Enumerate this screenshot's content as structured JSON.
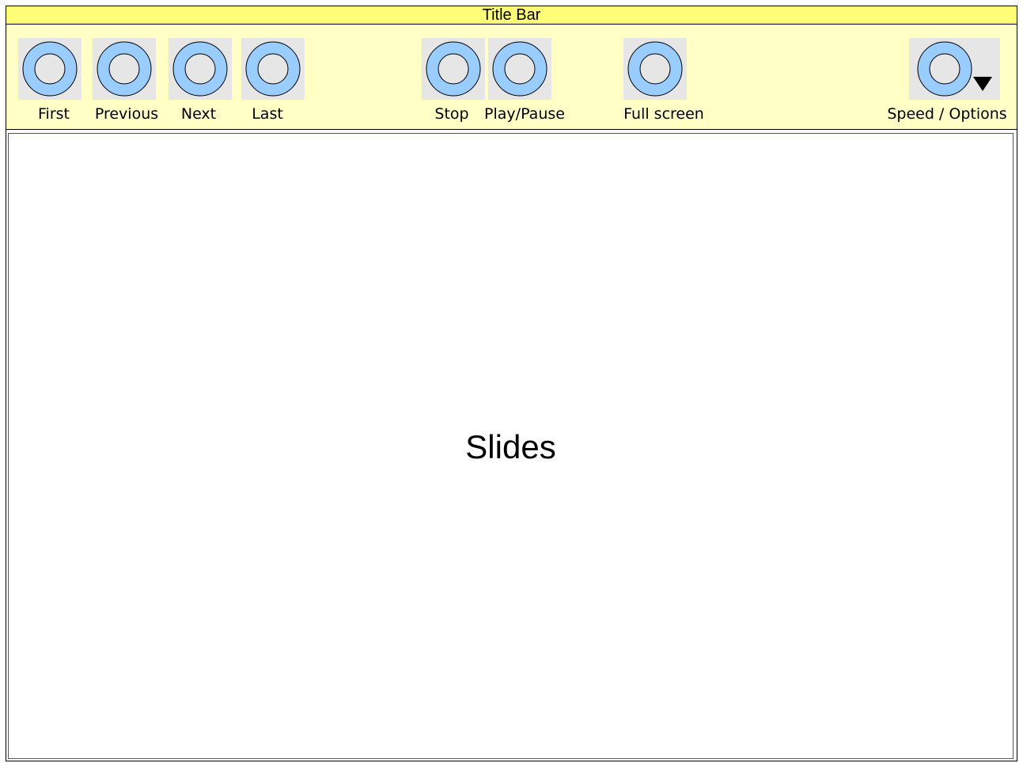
{
  "window": {
    "title": "Title Bar"
  },
  "colors": {
    "title_bar_bg": "#ffff77",
    "toolbar_bg": "#ffffc6",
    "button_bg": "#e6e6e6",
    "icon_ring": "#99ccff",
    "icon_center": "#e6e6e6"
  },
  "toolbar": {
    "first": {
      "label": "First",
      "icon": "circle-icon"
    },
    "previous": {
      "label": "Previous",
      "icon": "circle-icon"
    },
    "next": {
      "label": "Next",
      "icon": "circle-icon"
    },
    "last": {
      "label": "Last",
      "icon": "circle-icon"
    },
    "stop": {
      "label": "Stop",
      "icon": "circle-icon"
    },
    "play_pause": {
      "label": "Play/Pause",
      "icon": "circle-icon"
    },
    "full_screen": {
      "label": "Full screen",
      "icon": "circle-icon"
    },
    "speed_options": {
      "label": "Speed / Options",
      "icon": "circle-icon",
      "dropdown_icon": "triangle-down-icon"
    }
  },
  "main": {
    "slides_label": "Slides"
  }
}
